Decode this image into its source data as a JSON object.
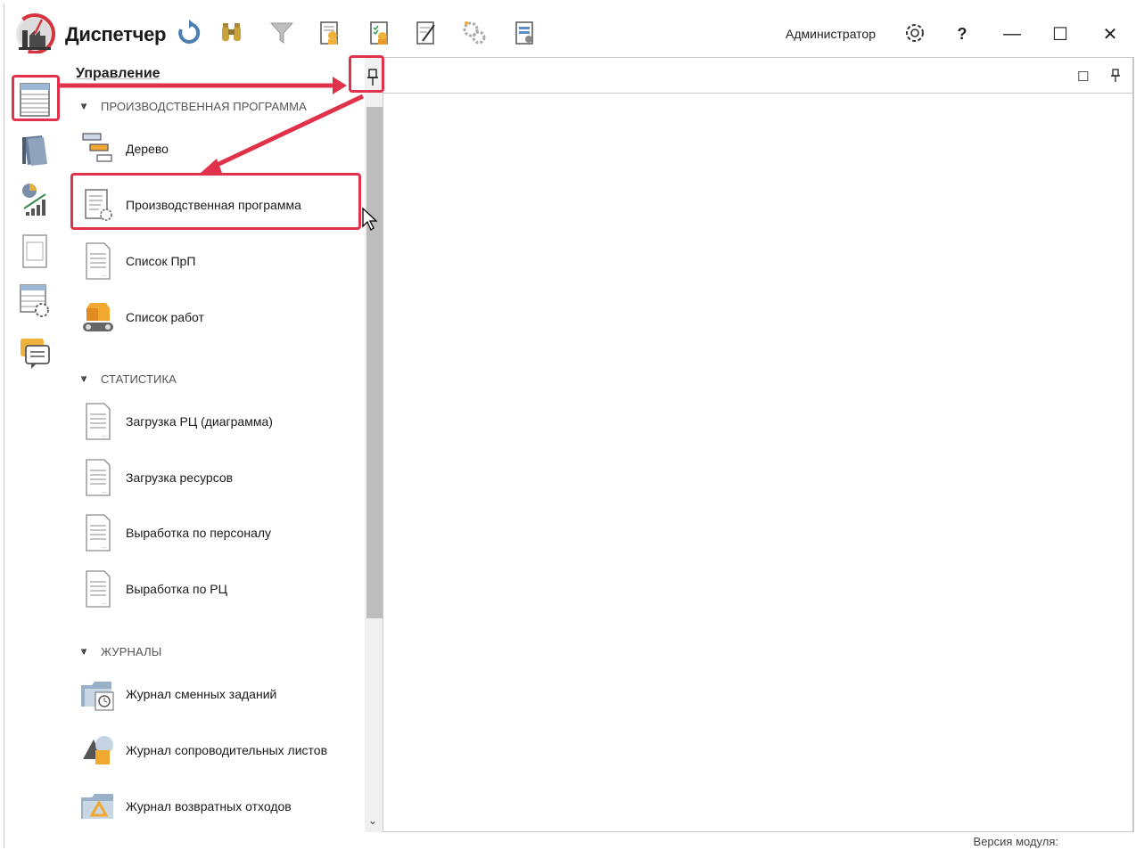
{
  "app": {
    "title": "Диспетчер"
  },
  "header": {
    "user": "Администратор",
    "help_label": "?",
    "toolbar_icons": [
      "refresh-icon",
      "binoculars-icon",
      "filter-icon",
      "worker-report-icon",
      "worker-checklist-icon",
      "edit-checklist-icon",
      "settings-gears-icon",
      "document-gear-icon"
    ]
  },
  "window_controls": {
    "minimize": "—",
    "maximize": "☐",
    "close": "✕"
  },
  "rail": {
    "items": [
      "table-list-icon",
      "books-icon",
      "analytics-icon",
      "document-frame-icon",
      "grid-settings-icon",
      "chat-icon"
    ]
  },
  "nav": {
    "title": "Управление",
    "sections": [
      {
        "label": "ПРОИЗВОДСТВЕННАЯ ПРОГРАММА",
        "items": [
          {
            "label": "Дерево",
            "icon": "tree-icon"
          },
          {
            "label": "Производственная программа",
            "icon": "program-icon"
          },
          {
            "label": "Список ПрП",
            "icon": "document-icon"
          },
          {
            "label": "Список работ",
            "icon": "conveyor-icon"
          }
        ]
      },
      {
        "label": "СТАТИСТИКА",
        "items": [
          {
            "label": "Загрузка РЦ (диаграмма)",
            "icon": "document-icon"
          },
          {
            "label": "Загрузка ресурсов",
            "icon": "document-icon"
          },
          {
            "label": "Выработка по персоналу",
            "icon": "document-icon"
          },
          {
            "label": "Выработка по РЦ",
            "icon": "document-icon"
          }
        ]
      },
      {
        "label": "ЖУРНАЛЫ",
        "items": [
          {
            "label": "Журнал сменных заданий",
            "icon": "folder-clock-icon"
          },
          {
            "label": "Журнал сопроводительных листов",
            "icon": "shapes-icon"
          },
          {
            "label": "Журнал возвратных отходов",
            "icon": "recycle-folder-icon"
          }
        ]
      }
    ]
  },
  "content": {
    "restore": "☐",
    "pin": "📌"
  },
  "status": {
    "module_version": "Версия модуля:"
  },
  "colors": {
    "highlight": "#e0334b",
    "accent_orange": "#f5a623"
  }
}
